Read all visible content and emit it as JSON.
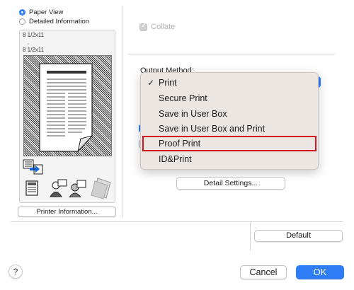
{
  "view_options": {
    "paper_view": "Paper View",
    "detailed_information": "Detailed Information",
    "selected": "Paper View"
  },
  "preview": {
    "original_size": "8 1/2x11",
    "output_size": "8 1/2x11",
    "arrow": "⌄"
  },
  "printer_information_label": "Printer Information...",
  "collate": {
    "label": "Collate",
    "checked": true,
    "enabled": false
  },
  "output_method": {
    "label": "Output Method:",
    "selected": "Print",
    "checkmark": "✓",
    "options": [
      "Print",
      "Secure Print",
      "Save in User Box",
      "Save in User Box and Print",
      "Proof Print",
      "ID&Print"
    ],
    "highlighted": "Proof Print"
  },
  "detail_settings_label": "Detail Settings...",
  "default_label": "Default",
  "cancel_label": "Cancel",
  "ok_label": "OK",
  "help_label": "?",
  "colors": {
    "accent": "#2f7df6",
    "highlight_box": "#d8121c",
    "menu_bg": "#ece6e3"
  },
  "icons": [
    "radio-selected-icon",
    "radio-unselected-icon",
    "paper-preview-icon",
    "output-tray-icon",
    "document-icon",
    "users-icon",
    "file-stack-icon",
    "checkbox-icon",
    "help-icon"
  ]
}
